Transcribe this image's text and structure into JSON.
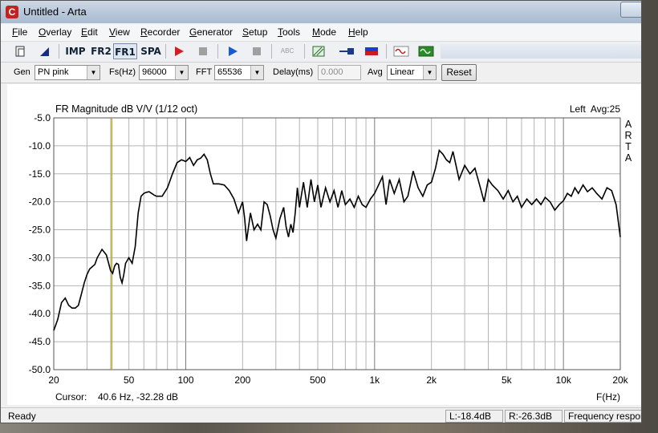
{
  "window": {
    "title": "Untitled - Arta",
    "app_icon": "C"
  },
  "menu": [
    "File",
    "Overlay",
    "Edit",
    "View",
    "Recorder",
    "Generator",
    "Setup",
    "Tools",
    "Mode",
    "Help"
  ],
  "toolbar": {
    "imp": "IMP",
    "fr2": "FR2",
    "fr1": "FR1",
    "spa": "SPA",
    "abc": "ABC"
  },
  "controls": {
    "gen_label": "Gen",
    "gen_value": "PN pink",
    "fs_label": "Fs(Hz)",
    "fs_value": "96000",
    "fft_label": "FFT",
    "fft_value": "65536",
    "delay_label": "Delay(ms)",
    "delay_value": "0.000",
    "avg_label": "Avg",
    "avg_value": "Linear",
    "reset_label": "Reset"
  },
  "graph": {
    "title": "FR Magnitude dB V/V (1/12 oct)",
    "channel_info": "Left  Avg:25",
    "arta_vertical": [
      "A",
      "R",
      "T",
      "A"
    ],
    "cursor_label": "Cursor:",
    "cursor_value": "40.6 Hz, -32.28 dB",
    "colors": {
      "trace": "#000000",
      "cursor": "#b8b020",
      "grid": "#b4b4b4",
      "grid_major": "#7a7a7a"
    }
  },
  "status": {
    "ready": "Ready",
    "left": "L:-18.4dB",
    "right": "R:-26.3dB",
    "mode": "Frequency respor"
  },
  "chart_data": {
    "type": "line",
    "title": "FR Magnitude dB V/V (1/12 oct)",
    "xlabel": "F(Hz)",
    "ylabel": "",
    "x_scale": "log",
    "xlim": [
      20,
      20000
    ],
    "ylim": [
      -50,
      -5
    ],
    "x_ticks": [
      20,
      50,
      100,
      200,
      500,
      1000,
      2000,
      5000,
      10000,
      20000
    ],
    "x_tick_labels": [
      "20",
      "50",
      "100",
      "200",
      "500",
      "1k",
      "2k",
      "5k",
      "10k",
      "20k"
    ],
    "y_ticks": [
      -5,
      -10,
      -15,
      -20,
      -25,
      -30,
      -35,
      -40,
      -45,
      -50
    ],
    "y_tick_labels": [
      "-5.0",
      "-10.0",
      "-15.0",
      "-20.0",
      "-25.0",
      "-30.0",
      "-35.0",
      "-40.0",
      "-45.0",
      "-50.0"
    ],
    "cursor_x": 40.6,
    "grid": true,
    "series": [
      {
        "x": [
          20,
          21,
          22,
          23,
          24,
          25,
          26,
          27,
          28,
          29,
          30,
          31,
          33,
          34,
          36,
          38,
          40,
          41,
          42,
          43,
          44,
          45,
          46,
          47,
          48,
          50,
          52,
          54,
          56,
          58,
          60,
          62,
          64,
          66,
          68,
          70,
          75,
          80,
          85,
          90,
          95,
          100,
          105,
          110,
          115,
          120,
          125,
          130,
          135,
          140,
          150,
          160,
          170,
          180,
          190,
          200,
          205,
          210,
          220,
          230,
          240,
          250,
          260,
          270,
          280,
          290,
          300,
          315,
          330,
          340,
          350,
          360,
          370,
          380,
          390,
          400,
          420,
          440,
          460,
          480,
          500,
          520,
          550,
          580,
          610,
          640,
          670,
          700,
          740,
          780,
          820,
          860,
          900,
          950,
          1000,
          1050,
          1100,
          1150,
          1200,
          1270,
          1350,
          1430,
          1500,
          1600,
          1700,
          1800,
          1900,
          2000,
          2100,
          2200,
          2300,
          2400,
          2500,
          2600,
          2800,
          3000,
          3200,
          3400,
          3600,
          3800,
          4000,
          4200,
          4500,
          4800,
          5100,
          5400,
          5700,
          6000,
          6400,
          6800,
          7200,
          7600,
          8000,
          8500,
          9000,
          9500,
          10000,
          10500,
          11000,
          11500,
          12000,
          12700,
          13400,
          14200,
          15000,
          16000,
          17000,
          18000,
          19000,
          20000
        ],
        "y": [
          -43,
          -41,
          -38,
          -37.2,
          -38.5,
          -39,
          -39,
          -38.5,
          -36.5,
          -34.5,
          -33,
          -32,
          -31.2,
          -30,
          -28.5,
          -29.5,
          -32.3,
          -32.8,
          -31.5,
          -31,
          -31.2,
          -33.5,
          -34.5,
          -33,
          -31,
          -30,
          -31,
          -28,
          -22,
          -19,
          -18.5,
          -18.3,
          -18.2,
          -18.5,
          -18.8,
          -19,
          -19,
          -17.5,
          -15,
          -13,
          -12.5,
          -12.8,
          -12.1,
          -13.5,
          -12.5,
          -12.2,
          -11.5,
          -12.5,
          -15,
          -16.8,
          -16.8,
          -17,
          -18,
          -19.5,
          -22,
          -20,
          -23,
          -27,
          -22,
          -25,
          -24,
          -25,
          -20,
          -20.5,
          -22.5,
          -25,
          -26.5,
          -23,
          -21,
          -24.5,
          -26.3,
          -24,
          -25.5,
          -22,
          -17.5,
          -21,
          -16.5,
          -21,
          -16,
          -20,
          -17,
          -21,
          -17.5,
          -20,
          -18,
          -21,
          -18,
          -20.5,
          -19.5,
          -21,
          -19,
          -20.5,
          -21,
          -19.5,
          -18.5,
          -17,
          -15.5,
          -20.5,
          -16,
          -18.5,
          -16,
          -20,
          -19,
          -14.5,
          -17.5,
          -19,
          -17,
          -16.5,
          -14,
          -10.8,
          -11.5,
          -12.5,
          -13,
          -11,
          -16,
          -13.5,
          -15,
          -14,
          -17,
          -20,
          -16,
          -17,
          -18,
          -19.5,
          -18,
          -20,
          -19,
          -21,
          -19.5,
          -20.5,
          -19.5,
          -20.5,
          -19.2,
          -20,
          -21.5,
          -20.5,
          -19.8,
          -18.5,
          -19,
          -17.5,
          -18.5,
          -17,
          -18.2,
          -17.5,
          -18.5,
          -19.5,
          -17.5,
          -18,
          -20.5,
          -26.3
        ]
      }
    ]
  }
}
